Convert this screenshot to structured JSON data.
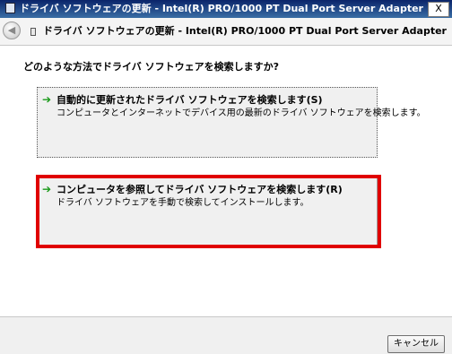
{
  "window": {
    "title": "ドライバ ソフトウェアの更新 - Intel(R) PRO/1000 PT Dual Port Server Adapter",
    "close_label": "X"
  },
  "header": {
    "title": "ドライバ ソフトウェアの更新 - Intel(R) PRO/1000 PT Dual Port Server Adapter",
    "back_icon": "back-arrow-icon"
  },
  "main": {
    "question": "どのような方法でドライバ ソフトウェアを検索しますか?",
    "options": [
      {
        "title": "自動的に更新されたドライバ ソフトウェアを検索します(S)",
        "description": "コンピュータとインターネットでデバイス用の最新のドライバ ソフトウェアを検索します。",
        "icon": "green-arrow-icon"
      },
      {
        "title": "コンピュータを参照してドライバ ソフトウェアを検索します(R)",
        "description": "ドライバ ソフトウェアを手動で検索してインストールします。",
        "icon": "green-arrow-icon",
        "highlighted": true
      }
    ]
  },
  "footer": {
    "cancel_label": "キャンセル"
  },
  "colors": {
    "highlight": "#e00000",
    "arrow": "#1a9a1a",
    "titlebar": "#0a246a"
  }
}
